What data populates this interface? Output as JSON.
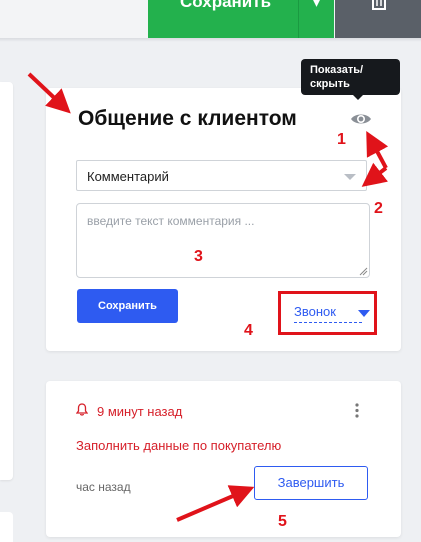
{
  "topbar": {
    "save_label": "Сохранить",
    "dropdown_glyph": "▾",
    "trash_icon": "trash-icon"
  },
  "comment_card": {
    "title": "Общение с клиентом",
    "visibility_icon": "eye-icon",
    "visibility_tooltip": "Показать/ скрыть",
    "comment_type": {
      "selected": "Комментарий"
    },
    "comment_input": {
      "value": "",
      "placeholder": "введите текст комментария ..."
    },
    "save_label": "Сохранить",
    "contact_type": {
      "selected": "Звонок"
    }
  },
  "task_card": {
    "due_text": "9 минут назад",
    "description": "Заполнить данные по покупателю",
    "created_text": "час назад",
    "complete_label": "Завершить"
  },
  "annotations": {
    "badges": [
      "1",
      "2",
      "3",
      "4",
      "5"
    ],
    "color": "#e0131a"
  },
  "colors": {
    "primary": "#2e5bf1",
    "success": "#23b14d",
    "danger": "#d6202a",
    "tooltip_bg": "#16191d"
  }
}
